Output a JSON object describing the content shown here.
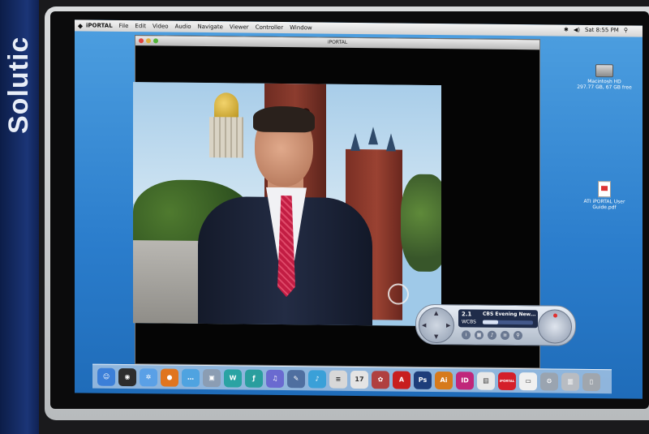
{
  "booth": {
    "banner_text": "Solutic"
  },
  "menubar": {
    "app_name": "iPORTAL",
    "items": [
      "File",
      "Edit",
      "Video",
      "Audio",
      "Navigate",
      "Viewer",
      "Controller",
      "Window"
    ],
    "clock": "Sat 8:55 PM"
  },
  "window": {
    "title": "iPORTAL"
  },
  "desktop_icons": [
    {
      "label": "Macintosh HD",
      "sublabel": "297.77 GB, 67 GB free"
    },
    {
      "label": "ATI iPORTAL User Guide.pdf"
    }
  ],
  "remote": {
    "channel": "2.1",
    "callsign": "WCBS",
    "program": "CBS Evening New...",
    "progress": 0.3
  },
  "dock_icons": [
    {
      "name": "finder-icon",
      "glyph": "☺",
      "color": "#3c7fd8"
    },
    {
      "name": "dashboard-icon",
      "glyph": "◉",
      "color": "#2d2d2d"
    },
    {
      "name": "safari-icon",
      "glyph": "✲",
      "color": "#5aa0e6"
    },
    {
      "name": "firefox-icon",
      "glyph": "●",
      "color": "#e0751f"
    },
    {
      "name": "ichat-icon",
      "glyph": "…",
      "color": "#4fa3e0"
    },
    {
      "name": "preview-icon",
      "glyph": "▣",
      "color": "#8b9db3"
    },
    {
      "name": "dreamweaver-icon",
      "glyph": "W",
      "color": "#2aa3a3"
    },
    {
      "name": "flash-icon",
      "glyph": "ƒ",
      "color": "#2a9e9e"
    },
    {
      "name": "itunes-icon",
      "glyph": "♫",
      "color": "#6a6ad0"
    },
    {
      "name": "quill-icon",
      "glyph": "✎",
      "color": "#4f6fa0"
    },
    {
      "name": "music-icon",
      "glyph": "♪",
      "color": "#3aa0d8"
    },
    {
      "name": "textedit-icon",
      "glyph": "≡",
      "color": "#d8d8d8"
    },
    {
      "name": "ical-icon",
      "glyph": "17",
      "color": "#e4e4e4"
    },
    {
      "name": "photo-icon",
      "glyph": "✿",
      "color": "#b04040"
    },
    {
      "name": "acrobat-icon",
      "glyph": "A",
      "color": "#c81e1e"
    },
    {
      "name": "photoshop-icon",
      "glyph": "Ps",
      "color": "#1d3d7a"
    },
    {
      "name": "illustrator-icon",
      "glyph": "Ai",
      "color": "#d67a1c"
    },
    {
      "name": "indesign-icon",
      "glyph": "ID",
      "color": "#c0267a"
    },
    {
      "name": "pages-icon",
      "glyph": "▤",
      "color": "#e8e8e8"
    },
    {
      "name": "iportal-icon",
      "glyph": "iPORTAL",
      "color": "#d41f2a"
    },
    {
      "name": "document-icon",
      "glyph": "▭",
      "color": "#f0f0f0"
    },
    {
      "name": "system-prefs-icon",
      "glyph": "⚙",
      "color": "#9aa4b0"
    },
    {
      "name": "drive-icon",
      "glyph": "▥",
      "color": "#b8bcc2"
    },
    {
      "name": "trash-icon",
      "glyph": "▯",
      "color": "#a0a6ad"
    }
  ]
}
